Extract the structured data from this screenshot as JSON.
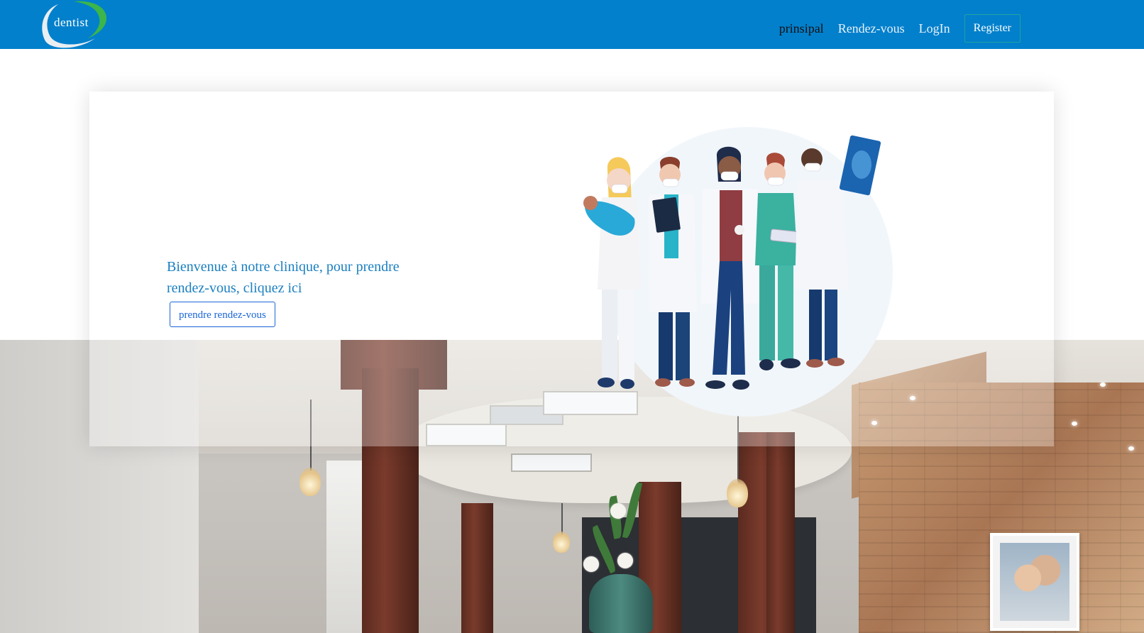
{
  "brand": {
    "logo_text": "dentist"
  },
  "nav": {
    "items": [
      {
        "label": "prinsipal",
        "active": true
      },
      {
        "label": "Rendez-vous",
        "active": false
      },
      {
        "label": "LogIn",
        "active": false
      }
    ],
    "register_label": "Register"
  },
  "hero": {
    "welcome_text": "Bienvenue à notre clinique, pour prendre rendez-vous, cliquez ici",
    "cta_label": "prendre rendez-vous"
  },
  "colors": {
    "navbar": "#0280cc",
    "accent_text": "#1a7fc0",
    "button_border": "#1a66d6",
    "logo_green": "#3cb54a"
  }
}
